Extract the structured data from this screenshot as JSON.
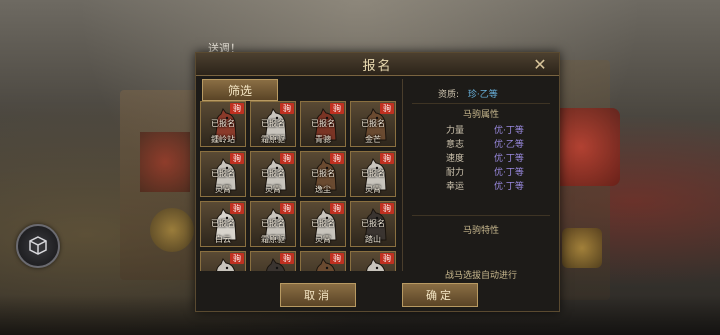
{
  "background": {
    "notice_text": "送週！"
  },
  "dialog": {
    "title": "报名",
    "filter_label": "筛选",
    "cancel_label": "取消",
    "confirm_label": "确定"
  },
  "horses": [
    {
      "name": "鍾岭站",
      "status": "已报名",
      "badge": "驹",
      "coat": "#8a3a2a"
    },
    {
      "name": "霜原驱",
      "status": "已报名",
      "badge": "驹",
      "coat": "#c8c4bc"
    },
    {
      "name": "青骢",
      "status": "已报名",
      "badge": "驹",
      "coat": "#7a3424"
    },
    {
      "name": "金芒",
      "status": "已报名",
      "badge": "驹",
      "coat": "#6a4a30"
    },
    {
      "name": "灵霄",
      "status": "已报名",
      "badge": "驹",
      "coat": "#c8c4bc"
    },
    {
      "name": "灵霄",
      "status": "已报名",
      "badge": "驹",
      "coat": "#c8c4bc"
    },
    {
      "name": "逸尘",
      "status": "已报名",
      "badge": "驹",
      "coat": "#6a4a30"
    },
    {
      "name": "灵霄",
      "status": "已报名",
      "badge": "驹",
      "coat": "#c8c4bc"
    },
    {
      "name": "白云",
      "status": "已报名",
      "badge": "驹",
      "coat": "#d8d4cc"
    },
    {
      "name": "霜原驱",
      "status": "已报名",
      "badge": "驹",
      "coat": "#c8c4bc"
    },
    {
      "name": "灵霄",
      "status": "已报名",
      "badge": "驹",
      "coat": "#c8c4bc"
    },
    {
      "name": "踏山",
      "status": "已报名",
      "badge": "驹",
      "coat": "#3a3430"
    },
    {
      "name": "",
      "status": "",
      "badge": "驹",
      "coat": "#c8c4bc"
    },
    {
      "name": "",
      "status": "",
      "badge": "驹",
      "coat": "#3a3430"
    },
    {
      "name": "",
      "status": "",
      "badge": "驹",
      "coat": "#6a4a30"
    },
    {
      "name": "",
      "status": "",
      "badge": "驹",
      "coat": "#c8c4bc"
    }
  ],
  "info": {
    "quality_label": "资质:",
    "quality_value": "珍·乙等",
    "attributes_title": "马驹属性",
    "attributes": [
      {
        "name": "力量",
        "value": "优·丁等"
      },
      {
        "name": "意志",
        "value": "优·乙等"
      },
      {
        "name": "速度",
        "value": "优·丁等"
      },
      {
        "name": "耐力",
        "value": "优·丁等"
      },
      {
        "name": "幸运",
        "value": "优·丁等"
      }
    ],
    "traits_title": "马驹特性",
    "auto_note": "战马选拔自动进行"
  },
  "colors": {
    "quality_value": "#6ab4e0",
    "attribute_value": "#9a8ae0",
    "badge": "#c03020"
  }
}
